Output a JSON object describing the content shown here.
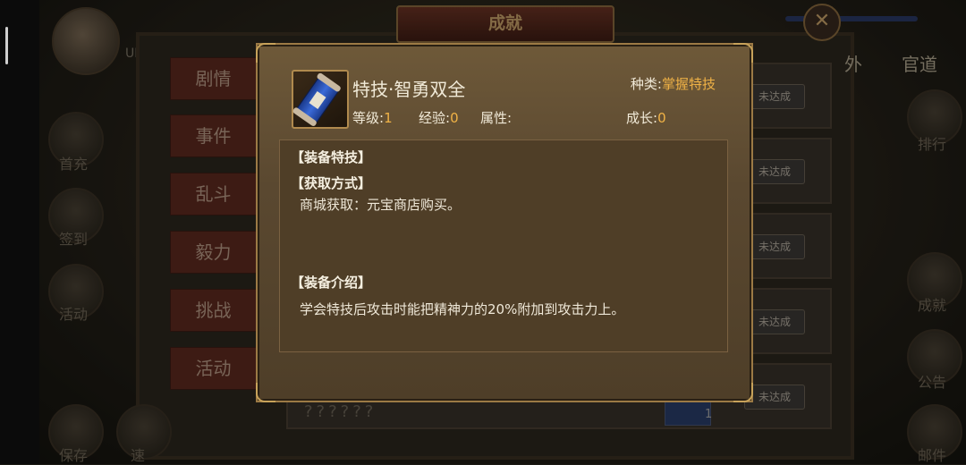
{
  "background": {
    "uid_label": "UID",
    "window_title": "成就",
    "close_icon": "close-x-icon",
    "left_tabs": [
      {
        "label": "剧情"
      },
      {
        "label": "事件"
      },
      {
        "label": "乱斗"
      },
      {
        "label": "毅力"
      },
      {
        "label": "挑战"
      },
      {
        "label": "活动"
      }
    ],
    "top_tabs": [
      {
        "label": "外"
      },
      {
        "label": "官道"
      }
    ],
    "rows_status": [
      "未达成",
      "未达成",
      "未达成",
      "未达成",
      "未达成"
    ],
    "hidden_name": "??????",
    "row_item_count": "1",
    "left_side_labels": [
      "首充",
      "签到",
      "活动",
      "保存",
      "速"
    ],
    "right_side_labels": [
      "排行",
      "成就",
      "公告",
      "邮件"
    ]
  },
  "modal": {
    "icon": "blue-scroll-icon",
    "skill_name": "特技·智勇双全",
    "category_label": "种类:",
    "category_value": "掌握特技",
    "level_label": "等级:",
    "level_value": "1",
    "exp_label": "经验:",
    "exp_value": "0",
    "attr_label": "属性:",
    "growth_label": "成长:",
    "growth_value": "0",
    "section_equip_skill": "【装备特技】",
    "section_obtain": "【获取方式】",
    "obtain_text": "商城获取：元宝商店购买。",
    "section_intro": "【装备介绍】",
    "intro_text": "学会特技后攻击时能把精神力的20%附加到攻击力上。"
  },
  "colors": {
    "accent_gold": "#f0b246",
    "modal_border": "#9c7a45",
    "tab_red": "#5e2a1f"
  }
}
